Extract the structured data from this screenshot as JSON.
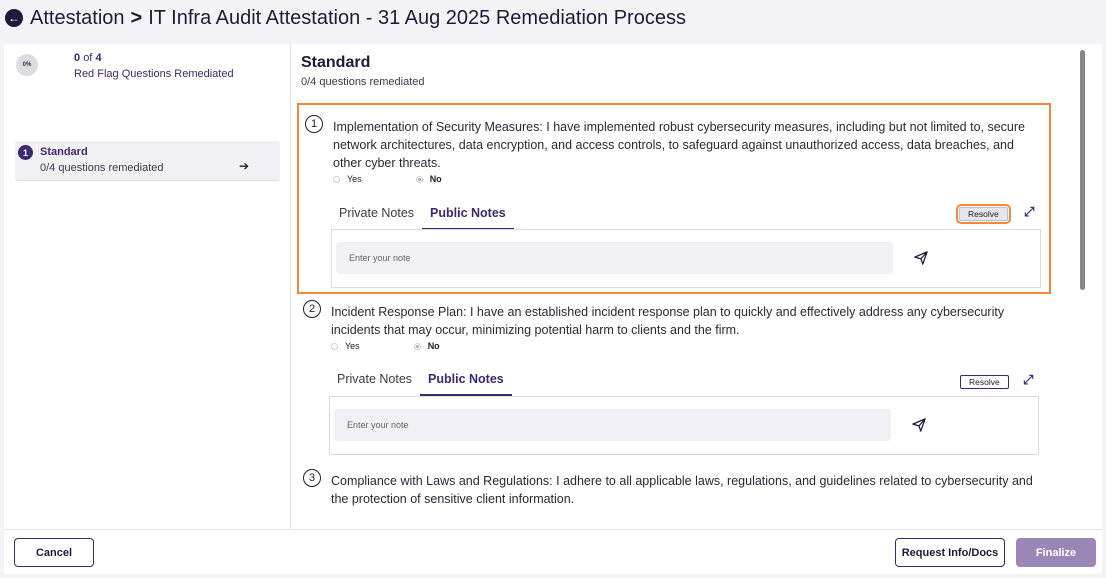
{
  "header": {
    "breadcrumb_root": "Attestation",
    "separator": ">",
    "title": "IT Infra Audit Attestation - 31 Aug 2025 Remediation Process"
  },
  "sidebar": {
    "progress_percent": "0%",
    "progress_count_value": "0",
    "progress_count_of": "of",
    "progress_count_total": "4",
    "progress_label": "Red Flag Questions Remediated",
    "items": [
      {
        "number": "1",
        "title": "Standard",
        "subtitle": "0/4 questions remediated"
      }
    ]
  },
  "section": {
    "title": "Standard",
    "subtitle": "0/4 questions remediated"
  },
  "questions": [
    {
      "number": "1",
      "text": "Implementation of Security Measures: I have implemented robust cybersecurity measures, including but not limited to, secure network architectures, data encryption, and access controls, to safeguard against unauthorized access, data breaches, and other cyber threats.",
      "yes_label": "Yes",
      "no_label": "No",
      "selected": "No",
      "tab_private": "Private Notes",
      "tab_public": "Public Notes",
      "active_tab": "Public Notes",
      "resolve_label": "Resolve",
      "note_placeholder": "Enter your note"
    },
    {
      "number": "2",
      "text": "Incident Response Plan: I have an established incident response plan to quickly and effectively address any cybersecurity incidents that may occur, minimizing potential harm to clients and the firm.",
      "yes_label": "Yes",
      "no_label": "No",
      "selected": "No",
      "tab_private": "Private Notes",
      "tab_public": "Public Notes",
      "active_tab": "Public Notes",
      "resolve_label": "Resolve",
      "note_placeholder": "Enter your note"
    },
    {
      "number": "3",
      "text": "Compliance with Laws and Regulations: I adhere to all applicable laws, regulations, and guidelines related to cybersecurity and the protection of sensitive client information."
    }
  ],
  "footer": {
    "cancel_label": "Cancel",
    "request_label": "Request Info/Docs",
    "finalize_label": "Finalize"
  },
  "colors": {
    "brand": "#3b2a6e",
    "highlight": "#f08a3a",
    "finalize_disabled": "#9a87b8"
  }
}
